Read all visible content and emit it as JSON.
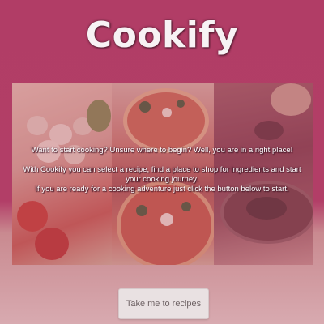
{
  "header": {
    "title": "Cookify"
  },
  "hero": {
    "images": [
      {
        "icon": "vegetables-photo"
      },
      {
        "icon": "pizza-photo"
      },
      {
        "icon": "cooking-pot-photo"
      }
    ],
    "intro_line_1": "Want to start cooking? Unsure where to begin? Well, you are in a right place!",
    "intro_line_2": "With Cookify you can select a recipe, find a place to shop for ingredients and start your cooking journey.",
    "intro_line_3": "If you are ready for a cooking adventure just click the button below to start."
  },
  "cta": {
    "label": "Take me to recipes"
  },
  "colors": {
    "background": "#b13d66",
    "background_bottom": "#d8aab0",
    "button": "#e9e1e2",
    "text": "#ffffff"
  }
}
